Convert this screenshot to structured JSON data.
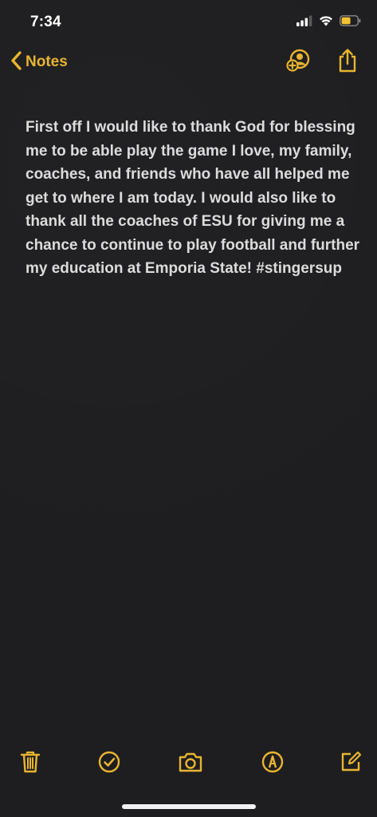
{
  "status_bar": {
    "time": "7:34",
    "battery_color": "#f2c230"
  },
  "nav": {
    "back_label": "Notes",
    "accent_color": "#e9b530",
    "icons": [
      "chevron-left-icon",
      "add-person-icon",
      "share-icon"
    ]
  },
  "note": {
    "text": "First off I would like to thank God for blessing me to be able play the game I love, my family, coaches, and friends who have all helped me get to where I am today. I would also like to thank all the coaches of ESU for giving me a chance to continue to play football and further my education at Emporia State! #stingersup"
  },
  "toolbar": {
    "icons": [
      "trash-icon",
      "checklist-icon",
      "camera-icon",
      "markup-icon",
      "compose-icon"
    ]
  }
}
